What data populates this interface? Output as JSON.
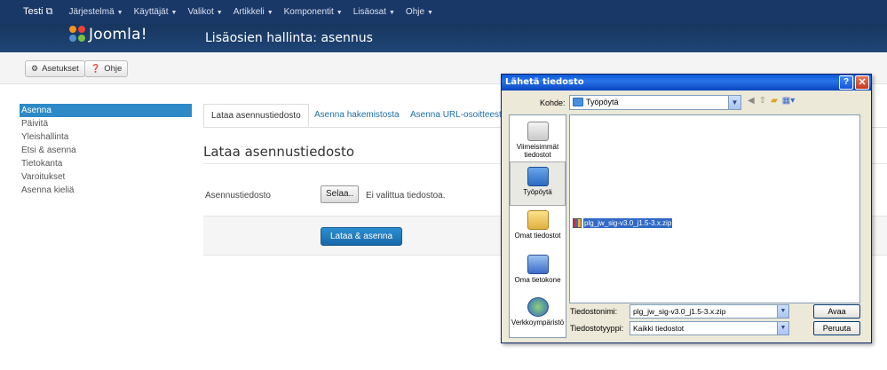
{
  "topbar": {
    "site_label": "Testi ⧉",
    "menus": [
      "Järjestelmä",
      "Käyttäjät",
      "Valikot",
      "Artikkeli",
      "Komponentit",
      "Lisäosat",
      "Ohje"
    ]
  },
  "header": {
    "logo_text": "Joomla!",
    "title": "Lisäosien hallinta: asennus"
  },
  "toolbar": {
    "settings_label": "Asetukset",
    "help_label": "Ohje"
  },
  "sidebar": {
    "items": [
      "Asenna",
      "Päivitä",
      "Yleishallinta",
      "Etsi & asenna",
      "Tietokanta",
      "Varoitukset",
      "Asenna kieliä"
    ],
    "active_index": 0
  },
  "tabs": [
    "Lataa asennustiedosto",
    "Asenna hakemistosta",
    "Asenna URL-osoitteest"
  ],
  "main": {
    "section_title": "Lataa asennustiedosto",
    "field_label": "Asennustiedosto",
    "browse_label": "Selaa..",
    "no_file_text": "Ei valittua tiedostoa.",
    "submit_label": "Lataa & asenna"
  },
  "dialog": {
    "title": "Lähetä tiedosto",
    "help_symbol": "?",
    "close_symbol": "✕",
    "look_in_label": "Kohde:",
    "look_in_value": "Työpöytä",
    "places": [
      "Viimeisimmät tiedostot",
      "Työpöytä",
      "Omat tiedostot",
      "Oma tietokone",
      "Verkkoympäristö"
    ],
    "selected_file": "plg_jw_sig-v3.0_j1.5-3.x.zip",
    "filename_label": "Tiedostonimi:",
    "filename_value": "plg_jw_sig-v3.0_j1.5-3.x.zip",
    "filetype_label": "Tiedostotyyppi:",
    "filetype_value": "Kaikki tiedostot",
    "open_label": "Avaa",
    "cancel_label": "Peruuta"
  },
  "colors": {
    "topbar": "#1a3867",
    "header": "#1f4576",
    "accent": "#2d8ac7",
    "dialog_title": "#0b5ad8"
  }
}
